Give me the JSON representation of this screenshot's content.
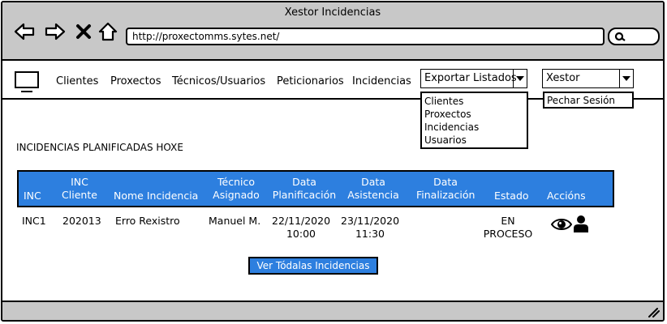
{
  "window": {
    "title": "Xestor Incidencias"
  },
  "browser": {
    "url": "http://proxectomms.sytes.net/"
  },
  "menu": {
    "items": [
      "Clientes",
      "Proxectos",
      "Técnicos/Usuarios",
      "Peticionarios",
      "Incidencias"
    ],
    "export": {
      "label": "Exportar Listados",
      "options": [
        "Clientes",
        "Proxectos",
        "Incidencias",
        "Usuarios"
      ]
    },
    "user": {
      "label": "Xestor",
      "options": [
        "Pechar Sesión"
      ]
    }
  },
  "section": {
    "title": "INCIDENCIAS PLANIFICADAS HOXE"
  },
  "table": {
    "headers": {
      "inc": "INC",
      "inc_cliente_1": "INC",
      "inc_cliente_2": "Cliente",
      "nome": "Nome Incidencia",
      "tecnico_1": "Técnico",
      "tecnico_2": "Asignado",
      "planif_1": "Data",
      "planif_2": "Planificación",
      "asist_1": "Data",
      "asist_2": "Asistencia",
      "final_1": "Data",
      "final_2": "Finalización",
      "estado": "Estado",
      "accions": "Accións"
    },
    "rows": [
      {
        "inc": "INC1",
        "inc_cliente": "202013",
        "nome": "Erro Rexistro",
        "tecnico": "Manuel M.",
        "planif_date": "22/11/2020",
        "planif_time": "10:00",
        "asist_date": "23/11/2020",
        "asist_time": "11:30",
        "final": "",
        "estado_1": "EN",
        "estado_2": "PROCESO"
      }
    ]
  },
  "button": {
    "view_all": "Ver Tódalas Incidencias"
  },
  "colors": {
    "accent": "#2d7fdf",
    "chrome": "#c8c8c8"
  }
}
